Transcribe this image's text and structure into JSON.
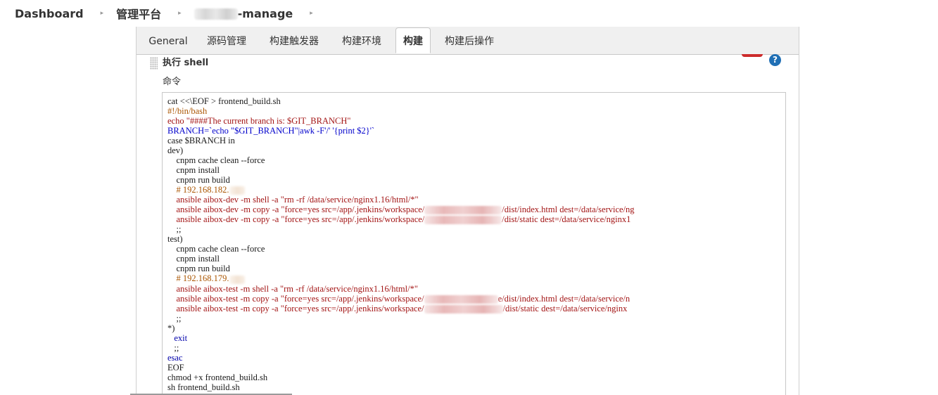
{
  "breadcrumb": {
    "items": [
      "Dashboard",
      "管理平台",
      "-manage"
    ],
    "separator": "▸"
  },
  "tabs": [
    {
      "label": "General",
      "active": false
    },
    {
      "label": "源码管理",
      "active": false
    },
    {
      "label": "构建触发器",
      "active": false
    },
    {
      "label": "构建环境",
      "active": false
    },
    {
      "label": "构建",
      "active": true
    },
    {
      "label": "构建后操作",
      "active": false
    }
  ],
  "step": {
    "title": "执行 shell",
    "help": "?",
    "field_label": "命令"
  },
  "code_lines": [
    "cat <<\\EOF > frontend_build.sh",
    "#!/bin/bash",
    "echo \"####The current branch is: $GIT_BRANCH\"",
    "BRANCH=`echo \"$GIT_BRANCH\"|awk -F'/' '{print $2}'`",
    "case $BRANCH in",
    "dev)",
    "    cnpm cache clean --force",
    "    cnpm install",
    "    cnpm run build",
    "    # 192.168.182.",
    "    ansible aibox-dev -m shell -a \"rm -rf /data/service/nginx1.16/html/*\"",
    "    ansible aibox-dev -m copy -a \"force=yes src=/app/.jenkins/workspace/",
    "/dist/index.html dest=/data/service/ng",
    "    ansible aibox-dev -m copy -a \"force=yes src=/app/.jenkins/workspace/",
    "/dist/static dest=/data/service/nginx1",
    "    ;;",
    "test)",
    "    cnpm cache clean --force",
    "    cnpm install",
    "    cnpm run build",
    "    # 192.168.179.",
    "    ansible aibox-test -m shell -a \"rm -rf /data/service/nginx1.16/html/*\"",
    "    ansible aibox-test -m copy -a \"force=yes src=/app/.jenkins/workspace/",
    "e/dist/index.html dest=/data/service/n",
    "    ansible aibox-test -m copy -a \"force=yes src=/app/.jenkins/workspace/",
    "/dist/static dest=/data/service/nginx",
    "    ;;",
    "*)",
    "   exit",
    "   ;;",
    "esac",
    "EOF",
    "chmod +x frontend_build.sh",
    "sh frontend_build.sh"
  ],
  "colors": {
    "keyword": "#0000aa",
    "string": "#a31515",
    "comment": "#aa5500",
    "help_icon": "#1f6fb5",
    "tab_bar": "#f0f0f0"
  }
}
